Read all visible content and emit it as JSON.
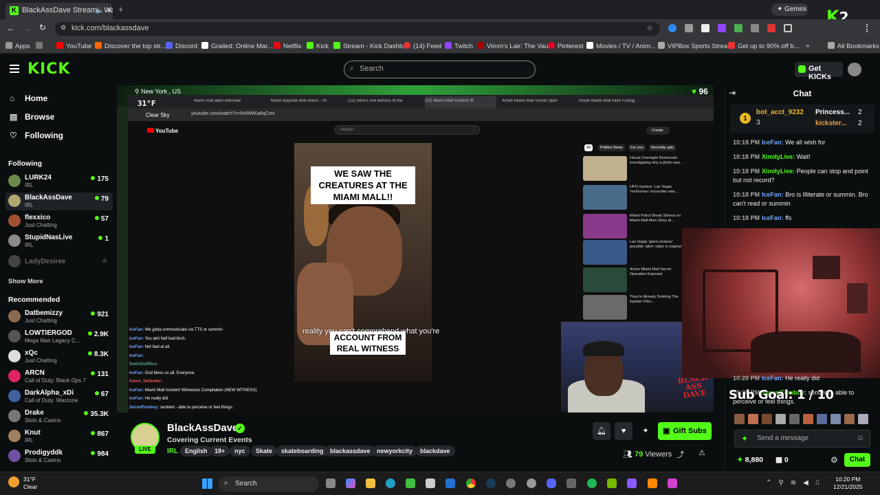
{
  "browser": {
    "tab_title": "BlackAssDave Stream - Wa",
    "url": "kick.com/blackassdave",
    "gemini_label": "Gemini",
    "bookmarks": [
      "Apps",
      "YouTube",
      "Discover the top str...",
      "Discord",
      "Grailed: Online Mar...",
      "Netflix",
      "Kick",
      "Stream - Kick Dashb...",
      "(14) Feed",
      "Twitch",
      "Vimm's Lair: The Vault",
      "Pinterest",
      "Movies / TV / Anim...",
      "VIPBox Sports Strea...",
      "Get up to 90% off b...",
      "All Bookmarks"
    ],
    "overlay_logo": "K",
    "overlay_count": "2"
  },
  "header": {
    "logo": "KICK",
    "search_placeholder": "Search",
    "get_kicks": "Get KICKs"
  },
  "sidebar": {
    "nav": [
      {
        "label": "Home",
        "icon": "home-icon"
      },
      {
        "label": "Browse",
        "icon": "browse-icon"
      },
      {
        "label": "Following",
        "icon": "heart-icon"
      }
    ],
    "following_header": "Following",
    "following": [
      {
        "name": "LURK24",
        "category": "IRL",
        "viewers": "175",
        "color": "#6a8a4a"
      },
      {
        "name": "BlackAssDave",
        "category": "IRL",
        "viewers": "79",
        "color": "#b0a870"
      },
      {
        "name": "flexxico",
        "category": "Just Chatting",
        "viewers": "57",
        "color": "#a05030"
      },
      {
        "name": "StupidNasLive",
        "category": "IRL",
        "viewers": "1",
        "color": "#8a8a8a"
      },
      {
        "name": "LadyDesiree",
        "category": "",
        "viewers": "",
        "color": "#444444"
      }
    ],
    "show_more": "Show More",
    "recommended_header": "Recommended",
    "recommended": [
      {
        "name": "Datbemizzy",
        "category": "Just Chatting",
        "viewers": "921",
        "color": "#8a6a50"
      },
      {
        "name": "LOWTIERGOD",
        "category": "Mega Man Legacy C...",
        "viewers": "2.9K",
        "color": "#555555"
      },
      {
        "name": "xQc",
        "category": "Just Chatting",
        "viewers": "8.3K",
        "color": "#dddddd"
      },
      {
        "name": "ARCN",
        "category": "Call of Duty: Black Ops 7",
        "viewers": "131",
        "color": "#e0245e"
      },
      {
        "name": "DarkAlpha_xDi",
        "category": "Call of Duty: Warzone",
        "viewers": "67",
        "color": "#4060a0"
      },
      {
        "name": "Drake",
        "category": "Slots & Casino",
        "viewers": "35.3K",
        "color": "#777777"
      },
      {
        "name": "Knut",
        "category": "IRL",
        "viewers": "867",
        "color": "#a08060"
      },
      {
        "name": "Prodigyddk",
        "category": "Slots & Casino",
        "viewers": "984",
        "color": "#7050a0"
      }
    ]
  },
  "video": {
    "weather_location": "New York , US",
    "temperature": "31°F",
    "condition": "Clear Sky",
    "likes": "96",
    "inner_tabs": [
      "Miami mall alien interview",
      "Miami Bayside Mall Aliens - Yo",
      "(22) Here's one witness of the",
      "(22) Miami Mall Incident W",
      "4chan Miami Mall Secret Oper",
      "Inside Miami Mall Alien Footag"
    ],
    "inner_url": "youtube.com/watch?v=hH9WKa8qCmc",
    "inner_search": "Search",
    "caption_top": "WE SAW THE CREATURES AT THE MIAMI MALL!!",
    "caption_bottom": "ACCOUNT FROM REAL WITNESS",
    "caption_overlay": "reality you can't comprehend what you're",
    "recs": [
      {
        "title": "House Oversight Democrats investigating why a photo was ...",
        "color": "#c0b090"
      },
      {
        "title": "UFO mystery: Las Vegas 'nonhuman' encounter was ...",
        "color": "#4a6a8a"
      },
      {
        "title": "Miami Police Break Silence on Miami Mall Alien Story at ...",
        "color": "#8a3a8a"
      },
      {
        "title": "Las Vegas 'giant creature' possible 'alien' video is original",
        "color": "#3a5a8a"
      },
      {
        "title": "4chan Miami Mall Secret Operation Exposed",
        "color": "#2a4a3a"
      },
      {
        "title": "They're Already Deleting The Epstein Files...",
        "color": "#6a6a6a"
      }
    ],
    "rec_chips": [
      "All",
      "Politics News",
      "For you",
      "Recently uplo"
    ],
    "inner_chat": [
      {
        "user": "IceFan:",
        "text": "We gotta communicate via TTS or summin"
      },
      {
        "user": "IceFan:",
        "text": "You aint half bad bruh."
      },
      {
        "user": "IceFan:",
        "text": "Not bad at all."
      },
      {
        "user": "IceFan:",
        "text": ""
      },
      {
        "user": "DashJustNics:",
        "text": ""
      },
      {
        "user": "IceFan:",
        "text": "God bless us all. Everyone."
      },
      {
        "user": "Karen_Defender:",
        "text": ""
      },
      {
        "user": "IceFan:",
        "text": "Miami Mall Incident Witnesses Compilation (NEW WITNESS)"
      },
      {
        "user": "IceFan:",
        "text": "He really did"
      },
      {
        "user": "SecretFemboy:",
        "text": "sentient - able to perceive or feel things."
      }
    ],
    "streamer_logo": "BLACK ASS DAVE"
  },
  "channel": {
    "name": "BlackAssDave",
    "title": "Covering Current Events",
    "category": "IRL",
    "live_label": "LIVE",
    "tags": [
      "English",
      "18+",
      "nyc",
      "Skate",
      "skateboarding",
      "blackassdave",
      "newyorkcity",
      "blackdave"
    ],
    "gift_subs": "Gift Subs",
    "viewers_count": "79",
    "viewers_label": "Viewers"
  },
  "chat": {
    "header": "Chat",
    "leaders": [
      {
        "name": "bot_acct_9232",
        "count": "3"
      },
      {
        "name": "Princess...",
        "count": "2"
      },
      {
        "name": "kickster...",
        "count": "2"
      }
    ],
    "messages": [
      {
        "time": "10:18 PM",
        "user": "IceFan:",
        "text": "We all wish for",
        "color": "#6fa8ff"
      },
      {
        "time": "10:18 PM",
        "user": "XimityLive:",
        "text": "Wait!",
        "color": "#53fc18"
      },
      {
        "time": "10:18 PM",
        "user": "XimityLive:",
        "text": "People can stop and point but not record?",
        "color": "#53fc18"
      },
      {
        "time": "10:18 PM",
        "user": "IceFan:",
        "text": "Bro is Illiterate or summin. Bro can't read or summin",
        "color": "#6fa8ff"
      },
      {
        "time": "10:18 PM",
        "user": "IceFan:",
        "text": "ffs",
        "color": "#6fa8ff"
      },
      {
        "time": "10:20 PM",
        "user": "IceFan:",
        "text": "He really did",
        "color": "#6fa8ff"
      },
      {
        "time": "10:20 PM",
        "user": "SecretFemboy:",
        "text": "sentient - able to perceive or feel things.",
        "color": "#53fc18"
      }
    ],
    "sub_goal": "Sub Goal: 1 / 10",
    "send_placeholder": "Send a message",
    "points": "8,880",
    "second_count": "0",
    "chat_button": "Chat"
  },
  "taskbar": {
    "weather_temp": "31°F",
    "weather_cond": "Clear",
    "search": "Search",
    "time": "10:20 PM",
    "date": "12/21/2025"
  }
}
